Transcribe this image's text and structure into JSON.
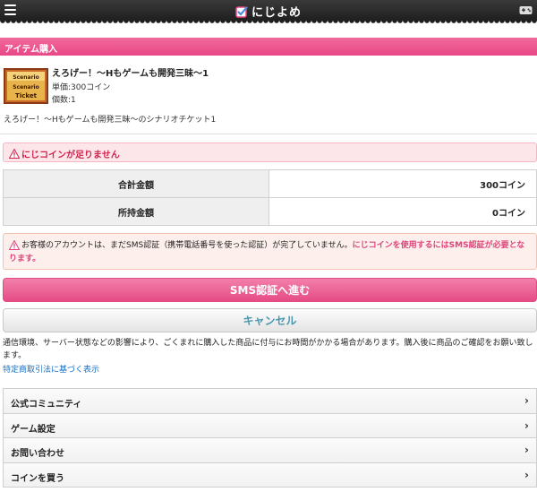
{
  "header": {
    "title": "にじよめ",
    "menu_icon": "hamburger-menu-icon",
    "game_icon": "gamepad-icon"
  },
  "section": {
    "title": "アイテム購入"
  },
  "item": {
    "name": "えろげー！～Hもゲームも開発三昧～1",
    "price": "単価:300コイン",
    "quantity": "個数:1",
    "description": "えろげー！～Hもゲームも開発三昧～のシナリオチケット1",
    "image_alt": "Scenario Ticket"
  },
  "error": {
    "message": "にじコインが足りません"
  },
  "summary": {
    "rows": [
      {
        "label": "合計金額",
        "value": "300コイン"
      },
      {
        "label": "所持金額",
        "value": "0コイン"
      }
    ]
  },
  "notice": {
    "text": "お客様のアカウントは、まだSMS認証（携帯電話番号を使った認証）が完了していません。",
    "emphasis": "にじコインを使用するにはSMS認証が必要となります。"
  },
  "buttons": {
    "sms": "SMS認証へ進む",
    "cancel": "キャンセル"
  },
  "disclaimer": "通信環境、サーバー状態などの影響により、ごくまれに購入した商品に付与にお時間がかかる場合があります。購入後に商品のご確認をお願い致します。",
  "law_link": "特定商取引法に基づく表示",
  "nav": {
    "items": [
      {
        "label": "公式コミュニティ"
      },
      {
        "label": "ゲーム設定"
      },
      {
        "label": "お問い合わせ"
      },
      {
        "label": "コインを買う"
      }
    ],
    "chevron": "›"
  },
  "colors": {
    "accent": "#e94786",
    "error_text": "#d2224c",
    "link": "#1a6fc2",
    "cancel_text": "#4a97b0"
  }
}
